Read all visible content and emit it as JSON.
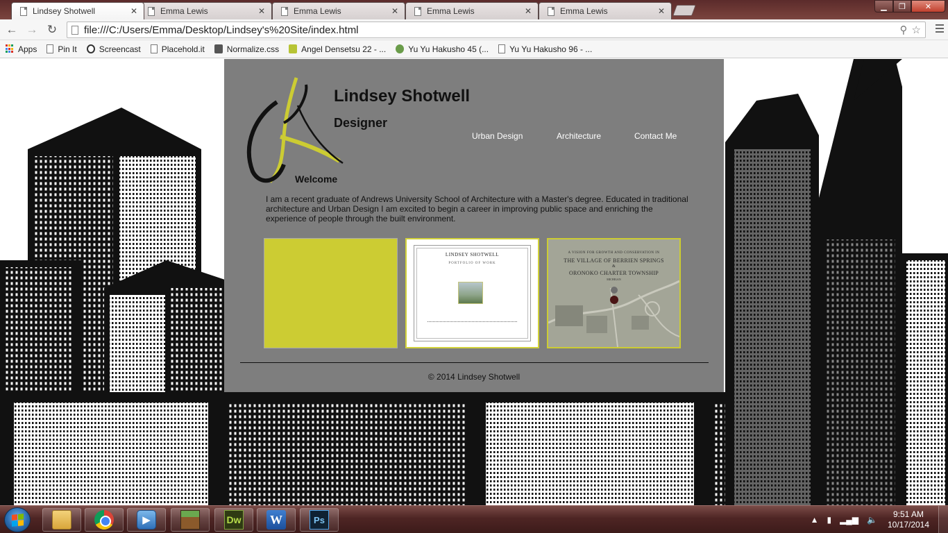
{
  "browser": {
    "tabs": [
      {
        "label": "Lindsey Shotwell",
        "active": true
      },
      {
        "label": "Emma Lewis",
        "active": false
      },
      {
        "label": "Emma Lewis",
        "active": false
      },
      {
        "label": "Emma Lewis",
        "active": false
      },
      {
        "label": "Emma Lewis",
        "active": false
      }
    ],
    "close_glyph": "✕",
    "url": "file:///C:/Users/Emma/Desktop/Lindsey's%20Site/index.html",
    "bookmarks": [
      {
        "label": "Apps",
        "icon": "apps-grid-icon"
      },
      {
        "label": "Pin It",
        "icon": "page-icon"
      },
      {
        "label": "Screencast",
        "icon": "screencast-icon"
      },
      {
        "label": "Placehold.it",
        "icon": "page-icon"
      },
      {
        "label": "Normalize.css",
        "icon": "avatar-icon"
      },
      {
        "label": "Angel Densetsu 22 - ...",
        "icon": "manga-icon"
      },
      {
        "label": "Yu Yu Hakusho 45 (...",
        "icon": "manga-icon"
      },
      {
        "label": "Yu Yu Hakusho 96 - ...",
        "icon": "page-icon"
      }
    ]
  },
  "site": {
    "name": "Lindsey Shotwell",
    "role": "Designer",
    "nav": {
      "urban": "Urban Design",
      "architecture": "Architecture",
      "contact": "Contact Me"
    },
    "welcome": "Welcome",
    "intro": "I am a recent graduate of Andrews University School of Architecture with a Master's degree. Educated in traditional architecture and Urban Design I am excited to begin a career in improving public space and enriching the experience of people through the built environment.",
    "portfolio_thumb": {
      "name": "LINDSEY SHOTWELL",
      "subtitle": "PORTFOLIO OF WORK"
    },
    "village_thumb": {
      "top": "A VISION FOR GROWTH AND CONSERVATION IN",
      "line1": "THE VILLAGE OF BERRIEN SPRINGS",
      "amp": "&",
      "line2": "ORONOKO CHARTER TOWNSHIP",
      "sub": "MICHIGAN"
    },
    "copyright": "© 2014 Lindsey Shotwell",
    "colors": {
      "panel": "#7e7e7e",
      "accent": "#cccc33"
    }
  },
  "taskbar": {
    "apps": [
      "explorer-icon",
      "chrome-icon",
      "media-player-icon",
      "minecraft-icon",
      "dreamweaver-icon",
      "word-icon",
      "photoshop-icon"
    ],
    "dw_label": "Dw",
    "word_label": "W",
    "ps_label": "Ps",
    "time": "9:51 AM",
    "date": "10/17/2014"
  }
}
